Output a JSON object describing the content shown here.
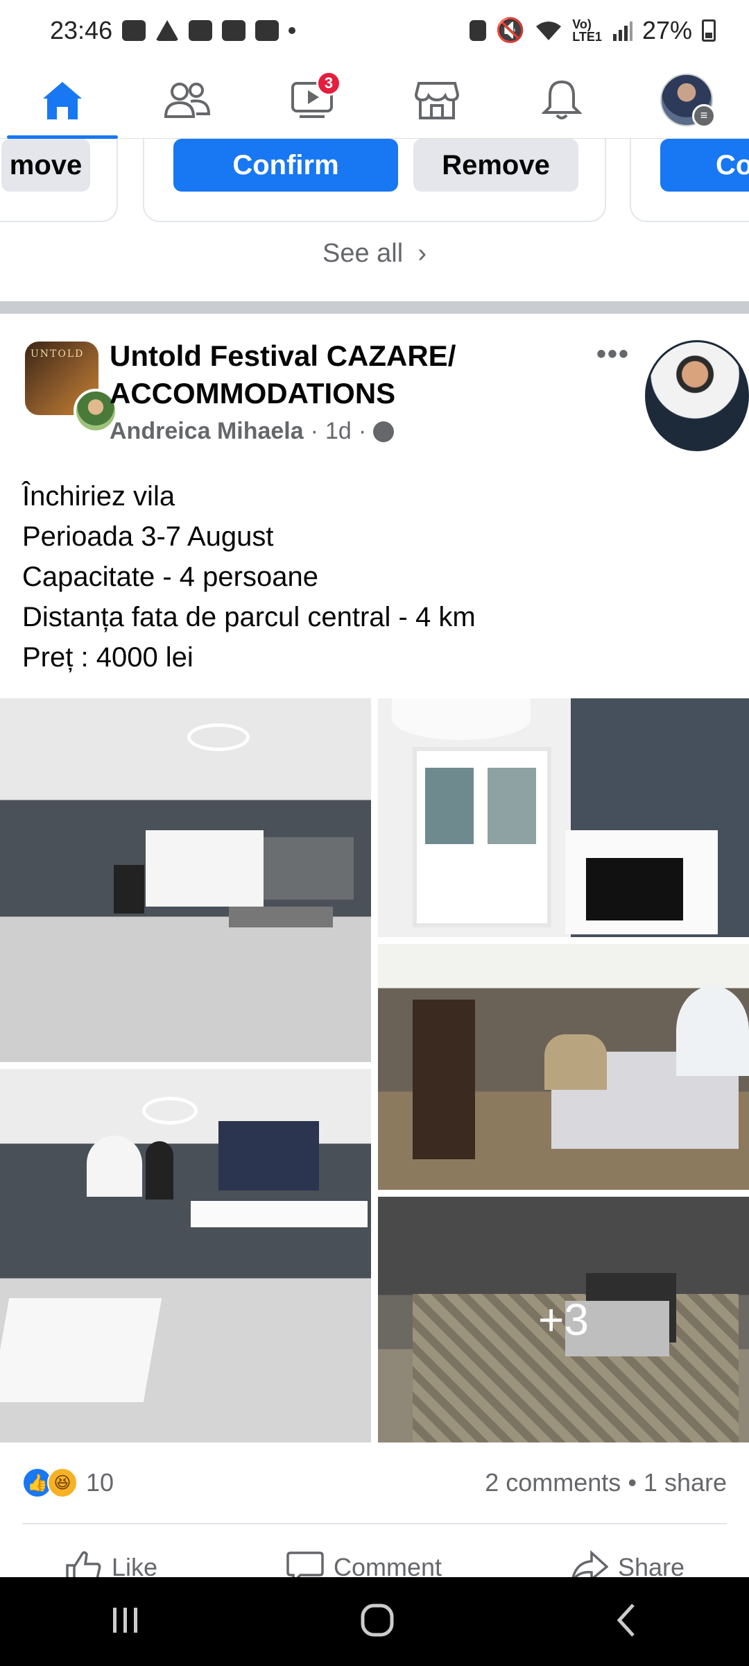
{
  "status_bar": {
    "time": "23:46",
    "battery": "27%"
  },
  "nav": {
    "items": [
      {
        "name": "home",
        "active": true
      },
      {
        "name": "friends"
      },
      {
        "name": "watch",
        "badge": "3"
      },
      {
        "name": "marketplace"
      },
      {
        "name": "notifications"
      },
      {
        "name": "menu"
      }
    ]
  },
  "friend_requests": {
    "left_remove_label": "move",
    "confirm_label": "Confirm",
    "remove_label": "Remove",
    "right_confirm_label": "Co",
    "see_all_label": "See all"
  },
  "post": {
    "group_name": "Untold Festival CAZARE/ ACCOMMODATIONS",
    "group_avatar_text": "UNTOLD",
    "author": "Andreica Mihaela",
    "time": "1d",
    "more_label": "•••",
    "text_lines": [
      "Închiriez vila",
      "Perioada 3-7 August",
      "Capacitate - 4 persoane",
      "Distanța fata de parcul central - 4 km",
      "Preț : 4000 lei"
    ],
    "photos_more": "+3",
    "reaction_count": "10",
    "comments": "2 comments",
    "shares": "1 share",
    "actions": {
      "like": "Like",
      "comment": "Comment",
      "share": "Share"
    }
  },
  "colors": {
    "brand": "#1877f2",
    "badge": "#e41e3f",
    "secondary_text": "#65676b"
  }
}
